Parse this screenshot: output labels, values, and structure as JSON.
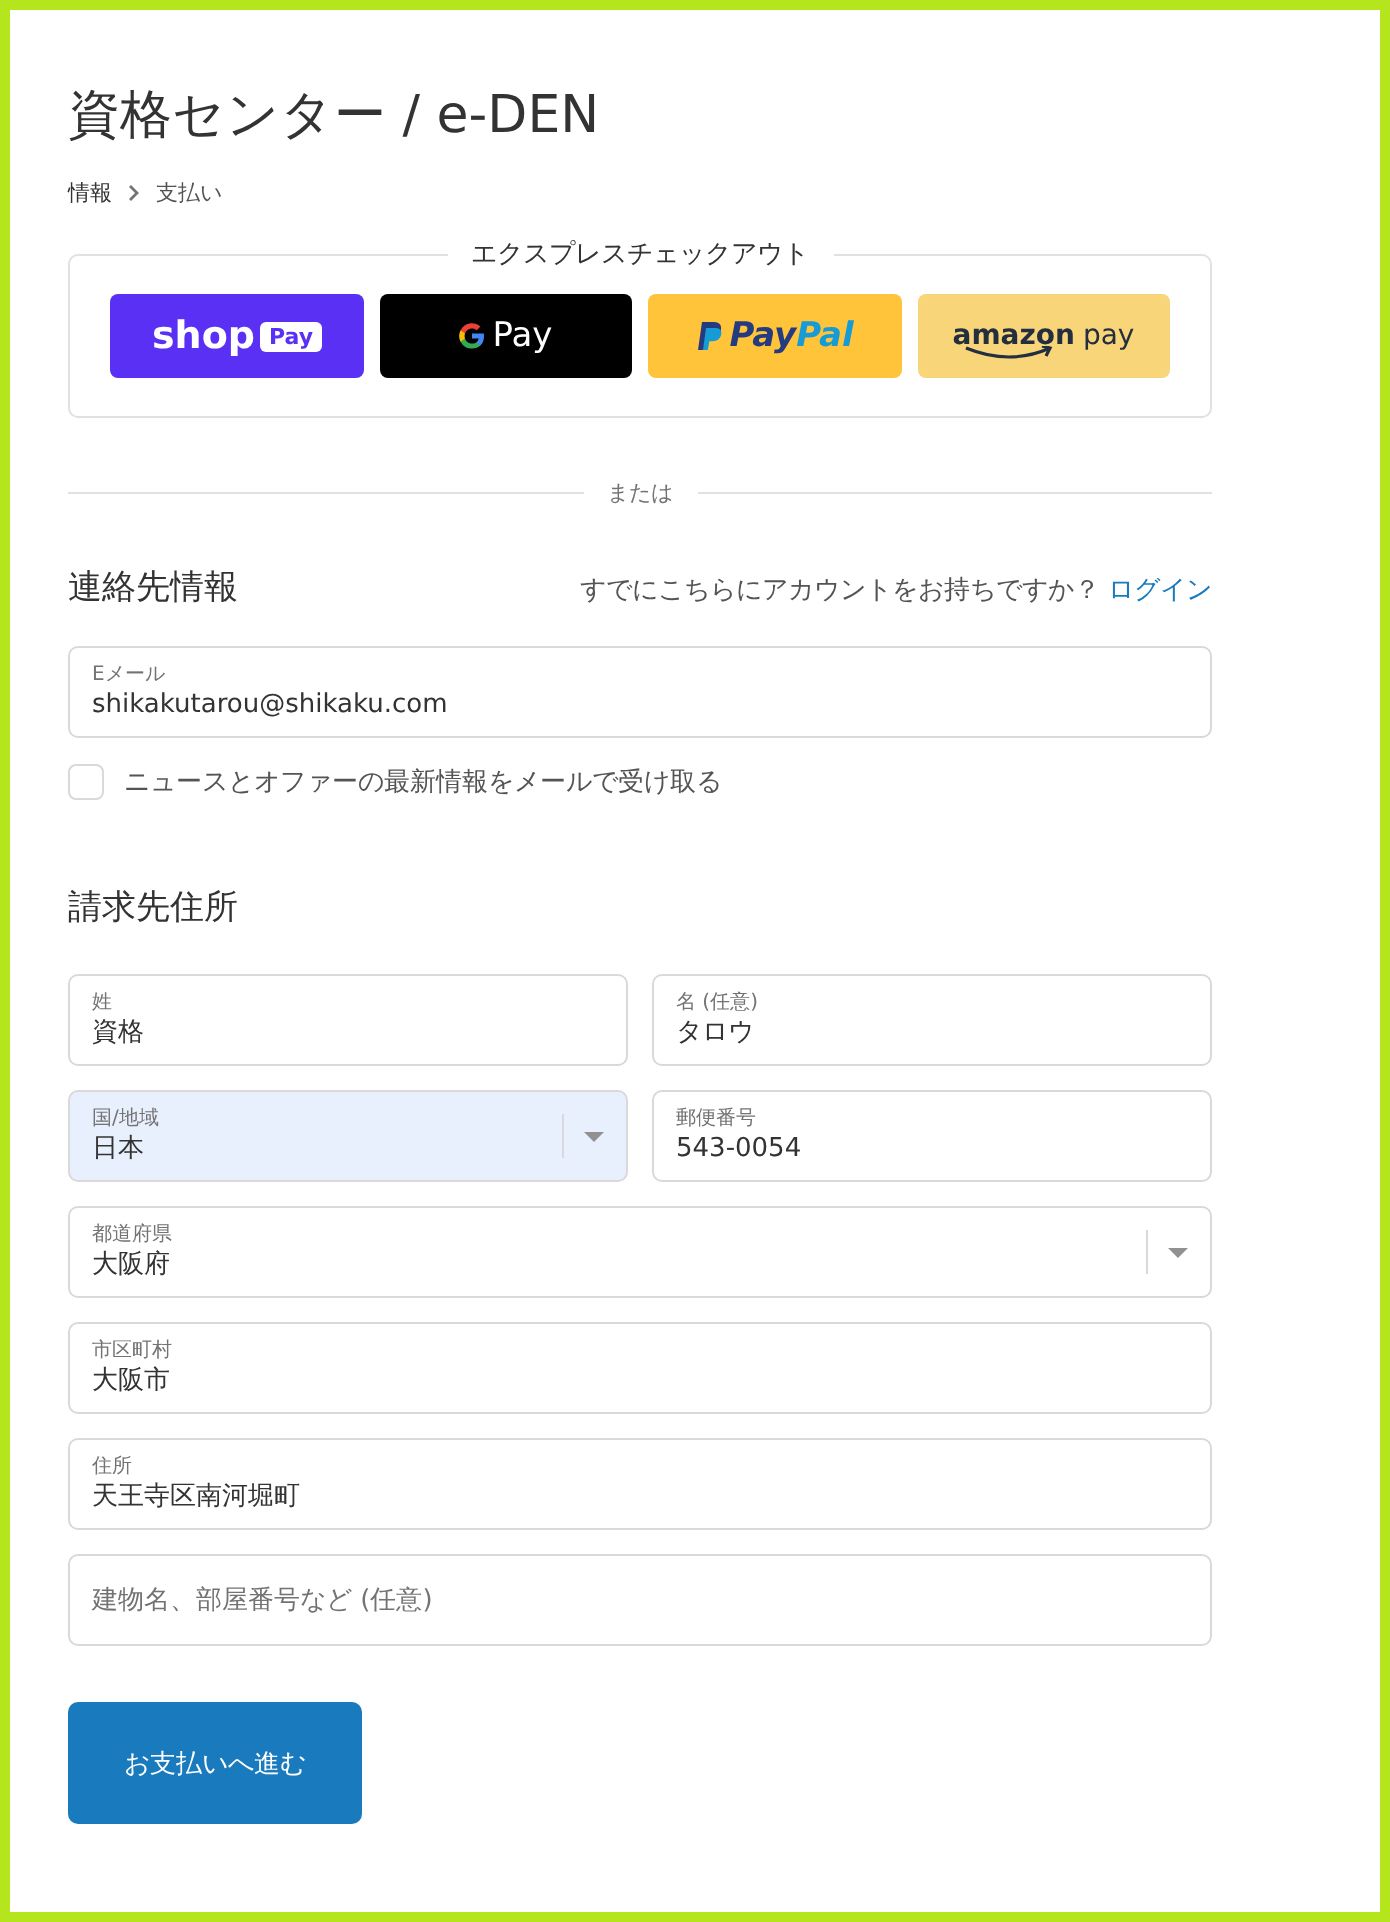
{
  "store_title": "資格センター / e-DEN",
  "breadcrumb": [
    {
      "label": "情報",
      "selected": false
    },
    {
      "label": "支払い",
      "selected": true
    }
  ],
  "express_checkout": {
    "legend": "エクスプレスチェックアウト",
    "buttons": [
      {
        "kind": "shop",
        "label": "shop",
        "badge": "Pay"
      },
      {
        "kind": "gpay",
        "label": "Pay"
      },
      {
        "kind": "paypal",
        "label": "Pay",
        "label_2": "Pal"
      },
      {
        "kind": "amazon",
        "label": "amazon",
        "label_2": "pay"
      }
    ]
  },
  "divider_text": "または",
  "contact": {
    "heading": "連絡先情報",
    "account_prompt": "すでにこちらにアカウントをお持ちですか？",
    "login_link": "ログイン",
    "email": {
      "label": "Eメール",
      "value": "shikakutarou@shikaku.com"
    },
    "newsletter": {
      "label": "ニュースとオファーの最新情報をメールで受け取る",
      "checked": false
    }
  },
  "billing": {
    "heading": "請求先住所",
    "rows": [
      [
        {
          "kind": "text",
          "label": "姓",
          "value": "資格",
          "autofilled": false
        },
        {
          "kind": "text",
          "label": "名 (任意)",
          "value": "タロウ",
          "autofilled": false
        }
      ],
      [
        {
          "kind": "select",
          "label": "国/地域",
          "value": "日本",
          "autofilled": true
        },
        {
          "kind": "text",
          "label": "郵便番号",
          "value": "543-0054",
          "autofilled": false
        }
      ],
      [
        {
          "kind": "select",
          "label": "都道府県",
          "value": "大阪府",
          "autofilled": false
        }
      ],
      [
        {
          "kind": "text",
          "label": "市区町村",
          "value": "大阪市",
          "autofilled": false
        }
      ],
      [
        {
          "kind": "text",
          "label": "住所",
          "value": "天王寺区南河堀町",
          "autofilled": false
        }
      ],
      [
        {
          "kind": "text",
          "placeholder": "建物名、部屋番号など (任意)",
          "autofilled": false
        }
      ]
    ]
  },
  "continue_button": "お支払いへ進む"
}
